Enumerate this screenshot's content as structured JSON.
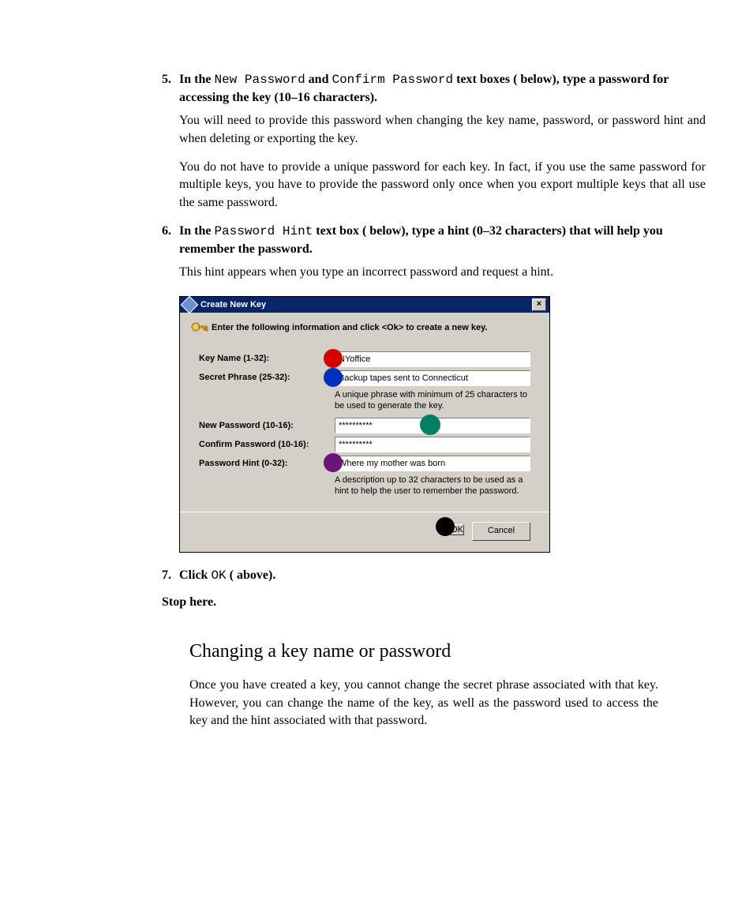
{
  "steps": {
    "s5": {
      "num": "5.",
      "lede_a": "In the ",
      "mono_a": "New Password",
      "lede_b": " and ",
      "mono_b": "Confirm Password",
      "lede_c": " text boxes (   below), type a password for accessing the key (10–16 characters).",
      "p1": "You will need to provide this password when changing the key name, password, or password hint and when deleting or exporting the key.",
      "p2": "You do not have to provide a unique password for each key. In fact, if you use the same password for multiple keys, you have to provide the password only once when you export multiple keys that all use the same password."
    },
    "s6": {
      "num": "6.",
      "lede_a": "In the ",
      "mono_a": "Password Hint",
      "lede_b": " text box (   below), type a hint (0–32 characters) that will help you remember the password.",
      "p1": "This hint appears when you type an incorrect password and request a hint."
    },
    "s7": {
      "num": "7.",
      "lede_a": "Click ",
      "mono_a": "OK",
      "lede_b": " (   above)."
    }
  },
  "stop": "Stop here.",
  "section_title": "Changing a key name or password",
  "section_para": "Once you have created a key, you cannot change the secret phrase associated with that key. However, you can change the name of the key, as well as the password used to access the key and the hint associated with that password.",
  "dialog": {
    "title": "Create New Key",
    "close": "×",
    "instruction": "Enter the following information and click <Ok> to create a new key.",
    "labels": {
      "key_name": "Key Name (1-32):",
      "secret_phrase": "Secret Phrase (25-32):",
      "new_password": "New Password (10-16):",
      "confirm_password": "Confirm Password (10-16):",
      "password_hint": "Password Hint (0-32):"
    },
    "values": {
      "key_name": "NYoffice",
      "secret_phrase": "Backup tapes sent to Connecticut",
      "new_password": "**********",
      "confirm_password": "**********",
      "password_hint": "Where my mother was born"
    },
    "help": {
      "secret_phrase": "A unique phrase with minimum of 25 characters to be used to generate the key.",
      "password_hint": "A description up to 32 characters to be used as a hint to help the user to remember the password."
    },
    "buttons": {
      "ok": "OK",
      "cancel": "Cancel"
    }
  }
}
